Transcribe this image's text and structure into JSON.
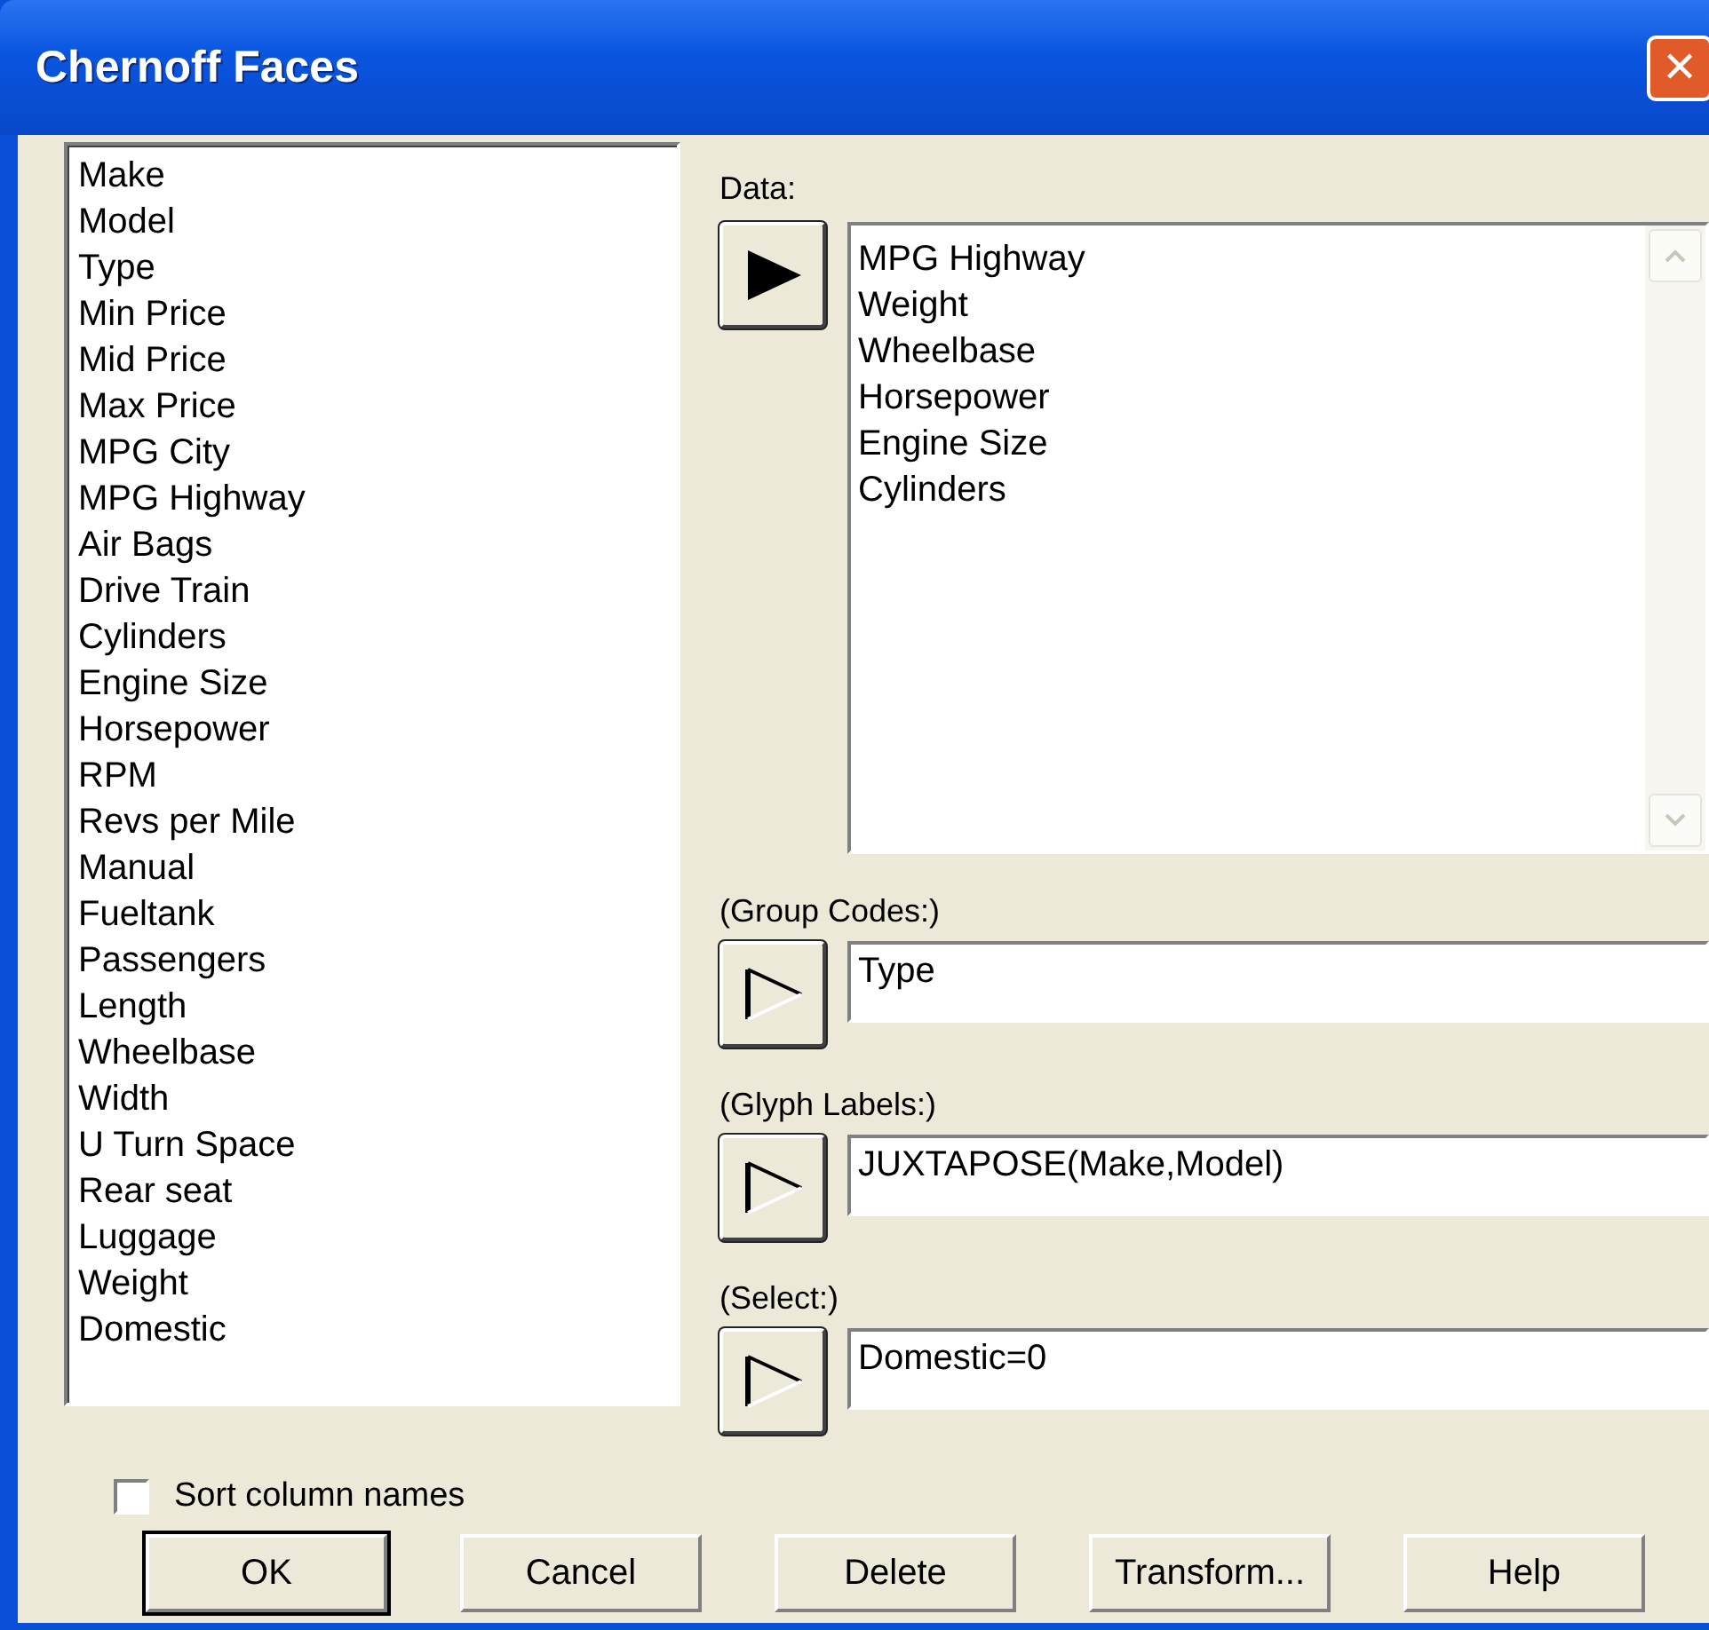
{
  "window": {
    "title": "Chernoff Faces",
    "close": "✕"
  },
  "columns": [
    "Make",
    "Model",
    "Type",
    "Min Price",
    "Mid Price",
    "Max Price",
    "MPG City",
    "MPG Highway",
    "Air Bags",
    "Drive Train",
    "Cylinders",
    "Engine Size",
    "Horsepower",
    "RPM",
    "Revs per Mile",
    "Manual",
    "Fueltank",
    "Passengers",
    "Length",
    "Wheelbase",
    "Width",
    "U Turn Space",
    "Rear seat",
    "Luggage",
    "Weight",
    "Domestic"
  ],
  "data": {
    "label": "Data:",
    "active": true,
    "items": [
      "MPG Highway",
      "Weight",
      "Wheelbase",
      "Horsepower",
      "Engine Size",
      "Cylinders"
    ]
  },
  "fields": [
    {
      "label": "(Group Codes:)",
      "value": "Type",
      "active": false
    },
    {
      "label": "(Glyph Labels:)",
      "value": "JUXTAPOSE(Make,Model)",
      "active": false
    },
    {
      "label": "(Select:)",
      "value": "Domestic=0",
      "active": false
    }
  ],
  "sort": {
    "label": "Sort column names",
    "checked": false
  },
  "buttons": [
    {
      "label": "OK",
      "default": true
    },
    {
      "label": "Cancel",
      "default": false
    },
    {
      "label": "Delete",
      "default": false
    },
    {
      "label": "Transform...",
      "default": false
    },
    {
      "label": "Help",
      "default": false
    }
  ]
}
